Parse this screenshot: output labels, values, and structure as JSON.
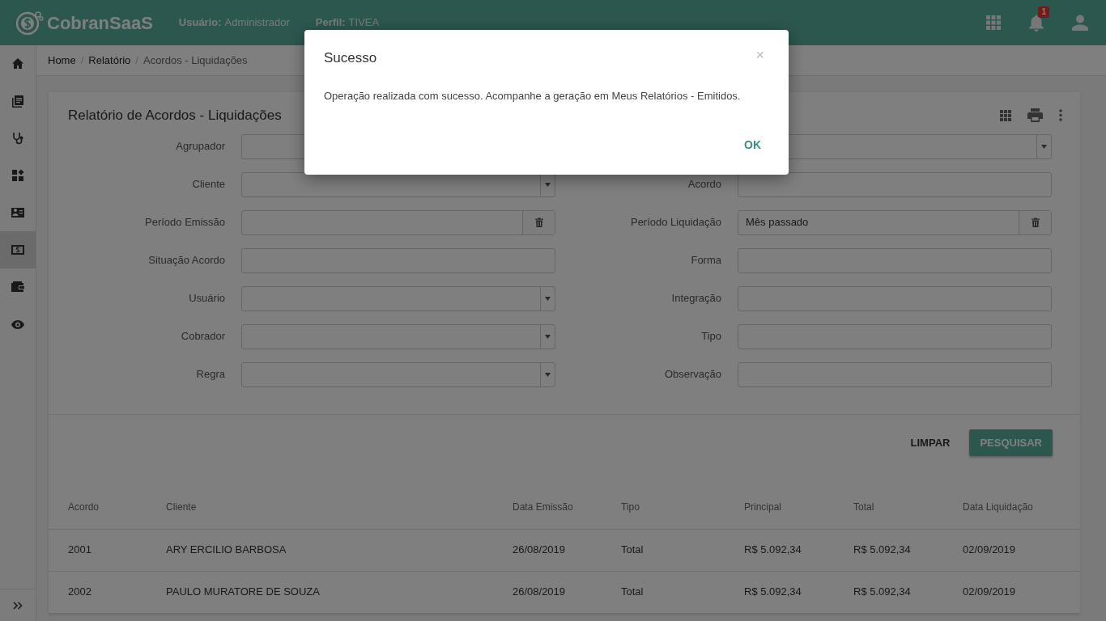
{
  "header": {
    "brand": "CobranSaaS",
    "user_label": "Usuário:",
    "user_value": "Administrador",
    "profile_label": "Perfil:",
    "profile_value": "TIVEA",
    "notification_count": "1"
  },
  "sidebar": {
    "items": [
      {
        "selected": false
      },
      {
        "selected": false
      },
      {
        "selected": false
      },
      {
        "selected": false
      },
      {
        "selected": false
      },
      {
        "selected": true
      },
      {
        "selected": false
      },
      {
        "selected": false
      }
    ]
  },
  "breadcrumb": [
    "Home",
    "Relatório",
    "Acordos - Liquidações"
  ],
  "breadcrumb_separator": "/",
  "report": {
    "title": "Relatório de Acordos - Liquidações",
    "filters_left": [
      {
        "label": "Agrupador",
        "kind": "select"
      },
      {
        "label": "Cliente",
        "kind": "select"
      },
      {
        "label": "Período Emissão",
        "kind": "date"
      },
      {
        "label": "Situação Acordo",
        "kind": "text"
      },
      {
        "label": "Usuário",
        "kind": "select"
      },
      {
        "label": "Cobrador",
        "kind": "select"
      },
      {
        "label": "Regra",
        "kind": "select"
      }
    ],
    "filters_right": [
      {
        "kind": "select"
      },
      {
        "label": "Acordo",
        "kind": "text"
      },
      {
        "label": "Período Liquidação",
        "kind": "date",
        "value": "Mês passado"
      },
      {
        "label": "Forma",
        "kind": "text"
      },
      {
        "label": "Integração",
        "kind": "text"
      },
      {
        "label": "Tipo",
        "kind": "text"
      },
      {
        "label": "Observação",
        "kind": "text"
      }
    ],
    "buttons": [
      "LIMPAR",
      "PESQUISAR"
    ]
  },
  "table": {
    "columns": [
      "Acordo",
      "Cliente",
      "Data Emissão",
      "Tipo",
      "Principal",
      "Total",
      "Data Liquidação"
    ],
    "rows": [
      [
        "2001",
        "ARY ERCILIO BARBOSA",
        "26/08/2019",
        "Total",
        "R$ 5.092,34",
        "R$ 5.092,34",
        "02/09/2019"
      ],
      [
        "2002",
        "PAULO MURATORE DE SOUZA",
        "26/08/2019",
        "Total",
        "R$ 5.092,34",
        "R$ 5.092,34",
        "02/09/2019"
      ]
    ]
  },
  "dialog": {
    "title": "Sucesso",
    "close": "×",
    "message": "Operação realizada com sucesso. Acompanhe a geração em Meus Relatórios - Emitidos.",
    "button": "OK"
  }
}
